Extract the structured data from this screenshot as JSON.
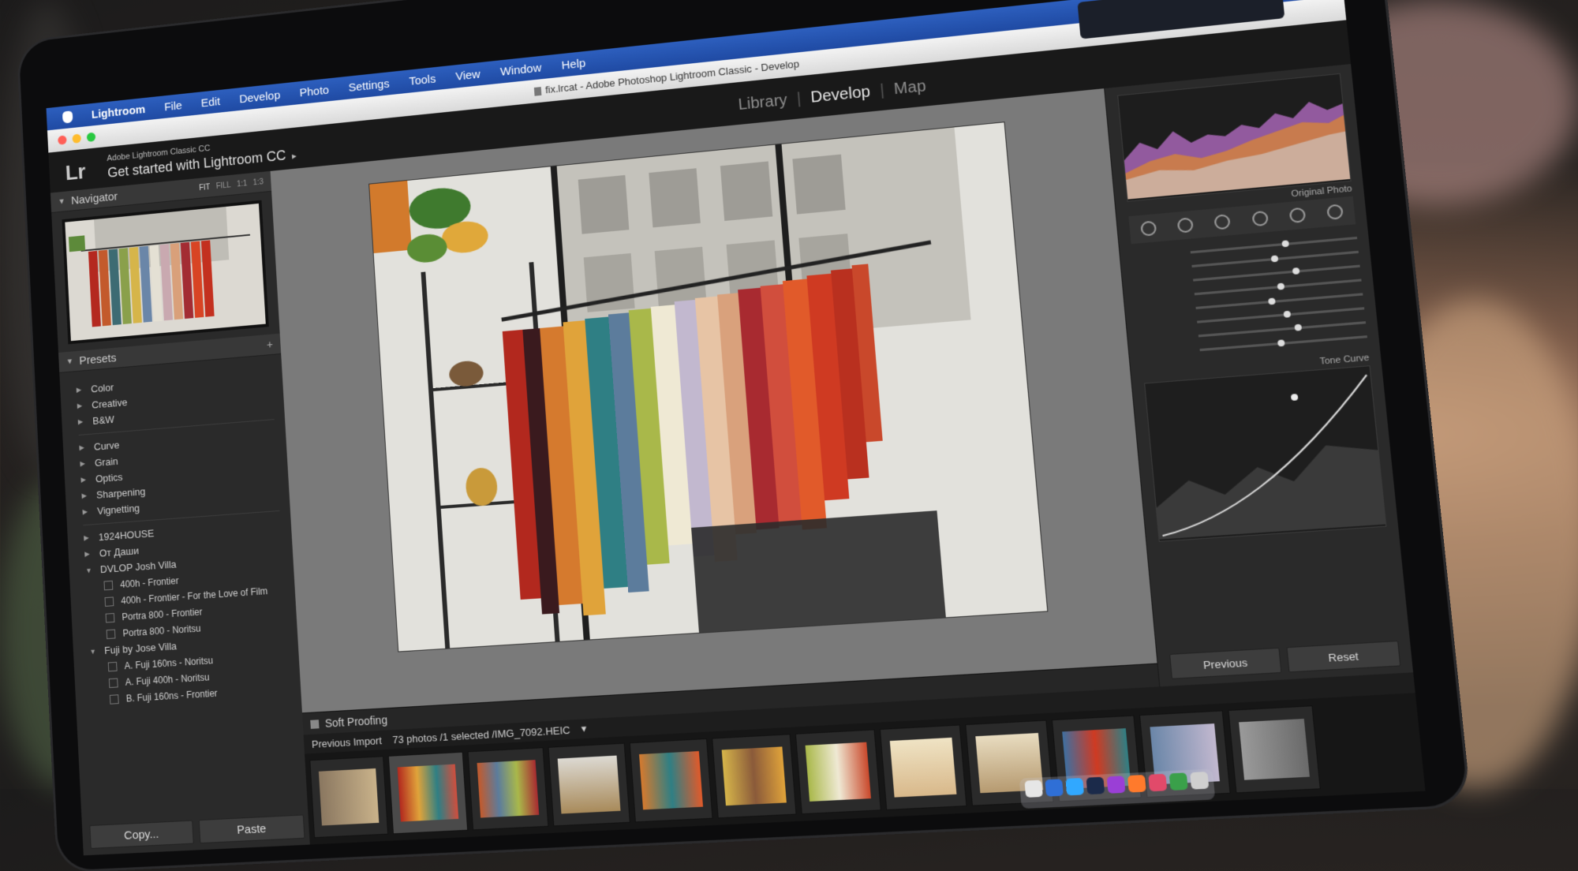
{
  "menubar": {
    "app": "Lightroom",
    "items": [
      "File",
      "Edit",
      "Develop",
      "Photo",
      "Settings",
      "Tools",
      "View",
      "Window",
      "Help"
    ]
  },
  "window": {
    "title": "fix.lrcat - Adobe Photoshop Lightroom Classic - Develop"
  },
  "identity": {
    "logo": "Lr",
    "subtitle": "Adobe Lightroom Classic CC",
    "title": "Get started with Lightroom CC",
    "arrow": "▸"
  },
  "modules": [
    "Library",
    "Develop",
    "Map"
  ],
  "navigator": {
    "title": "Navigator",
    "options": [
      "FIT",
      "FILL",
      "1:1",
      "1:3"
    ]
  },
  "presets": {
    "title": "Presets",
    "add_icon": "+",
    "group1": [
      "Color",
      "Creative",
      "B&W"
    ],
    "group2": [
      "Curve",
      "Grain",
      "Optics",
      "Sharpening",
      "Vignetting"
    ],
    "group3": {
      "items": [
        "1924HOUSE",
        "От Даши"
      ],
      "dvlop": {
        "label": "DVLOP Josh Villa",
        "children": [
          "400h - Frontier",
          "400h - Frontier - For the Love of Film",
          "Portra 800 - Frontier",
          "Portra 800 - Noritsu"
        ]
      },
      "fuji": {
        "label": "Fuji by Jose Villa",
        "children": [
          "A. Fuji 160ns - Noritsu",
          "A. Fuji 400h - Noritsu",
          "B. Fuji 160ns - Frontier"
        ]
      }
    }
  },
  "left_buttons": {
    "copy": "Copy...",
    "paste": "Paste"
  },
  "toolbar": {
    "soft_proofing": "Soft Proofing"
  },
  "filmstrip": {
    "source": "Previous Import",
    "status": "73 photos /1 selected /IMG_7092.HEIC",
    "dropdown": "▾"
  },
  "right_panel": {
    "histogram_label": "Histogram",
    "original_photo": "Original Photo",
    "tone_curve": "Tone Curve",
    "previous": "Previous",
    "reset": "Reset"
  },
  "colors": {
    "menubar": "#2d5fbe",
    "panel": "#2a2a2a",
    "workspace": "#7a7a7a",
    "accent_red": "#c9482b",
    "accent_orange": "#e08a2c"
  },
  "icons": {
    "apple": "apple-icon",
    "triangle": "disclosure-triangle-icon",
    "checkbox": "preset-checkbox-icon"
  }
}
